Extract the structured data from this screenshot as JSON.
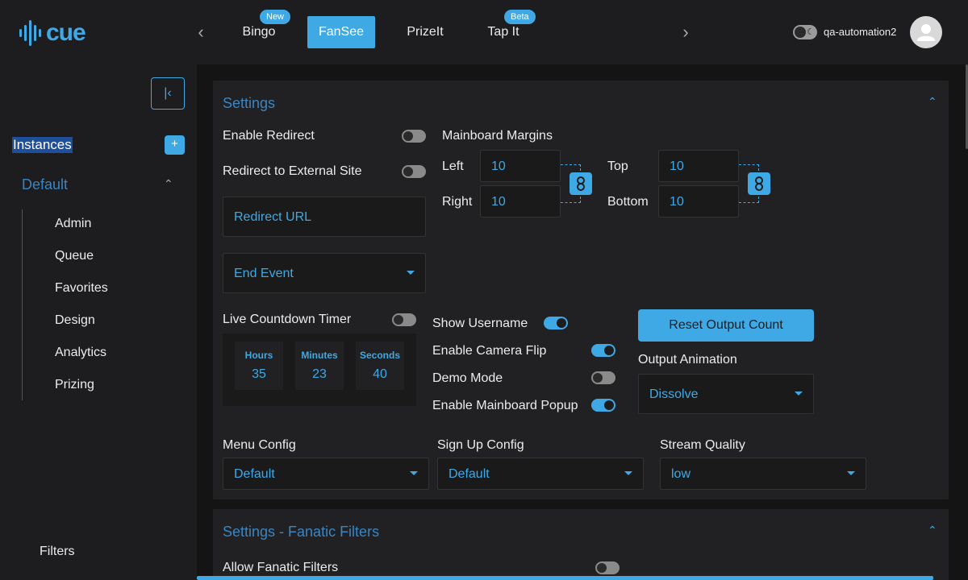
{
  "brand": {
    "name": "cue",
    "accent": "#3fa9e6"
  },
  "games": [
    {
      "label": "Bingo",
      "badge": "New"
    },
    {
      "label": "FanSee",
      "badge": ""
    },
    {
      "label": "PrizeIt",
      "badge": ""
    },
    {
      "label": "Tap It",
      "badge": "Beta"
    }
  ],
  "active_game": "FanSee",
  "user": {
    "name": "qa-automation2"
  },
  "sidebar": {
    "instances_label": "Instances",
    "add_label": "+",
    "group_label": "Default",
    "items": [
      "Admin",
      "Queue",
      "Favorites",
      "Design",
      "Analytics",
      "Prizing"
    ],
    "filters_label": "Filters"
  },
  "settings": {
    "title": "Settings",
    "enable_redirect": {
      "label": "Enable Redirect",
      "on": false
    },
    "redirect_external": {
      "label": "Redirect to External Site",
      "on": false
    },
    "redirect_url": {
      "placeholder": "Redirect URL"
    },
    "end_event": {
      "value": "End Event"
    },
    "margins": {
      "title": "Mainboard Margins",
      "left_label": "Left",
      "left_value": "10",
      "right_label": "Right",
      "right_value": "10",
      "top_label": "Top",
      "top_value": "10",
      "bottom_label": "Bottom",
      "bottom_value": "10"
    },
    "countdown": {
      "label": "Live Countdown Timer",
      "on": false,
      "hours_label": "Hours",
      "hours": "35",
      "minutes_label": "Minutes",
      "minutes": "23",
      "seconds_label": "Seconds",
      "seconds": "40"
    },
    "show_username": {
      "label": "Show Username",
      "on": true
    },
    "camera_flip": {
      "label": "Enable Camera Flip",
      "on": true
    },
    "demo_mode": {
      "label": "Demo Mode",
      "on": false
    },
    "mainboard_popup": {
      "label": "Enable Mainboard Popup",
      "on": true
    },
    "reset_output": {
      "label": "Reset Output Count"
    },
    "output_animation": {
      "label": "Output Animation",
      "value": "Dissolve"
    },
    "menu_config": {
      "label": "Menu Config",
      "value": "Default"
    },
    "signup_config": {
      "label": "Sign Up Config",
      "value": "Default"
    },
    "stream_quality": {
      "label": "Stream Quality",
      "value": "low"
    }
  },
  "fanatic": {
    "title": "Settings - Fanatic Filters",
    "allow": {
      "label": "Allow Fanatic Filters",
      "on": false
    }
  }
}
